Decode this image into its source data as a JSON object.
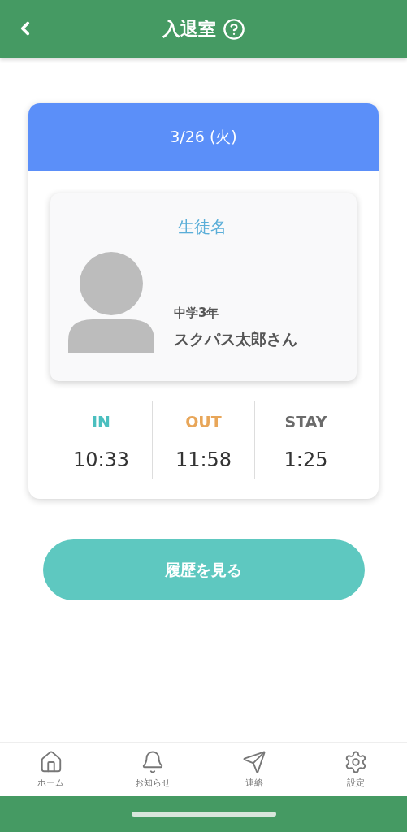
{
  "header": {
    "title": "入退室"
  },
  "record": {
    "date": "3/26 (火)",
    "student_label": "生徒名",
    "grade": "中学3年",
    "name": "スクパス太郎さん",
    "times": [
      {
        "label": "IN",
        "value": "10:33",
        "color": "#4bbfbf"
      },
      {
        "label": "OUT",
        "value": "11:58",
        "color": "#e8a659"
      },
      {
        "label": "STAY",
        "value": "1:25",
        "color": "#6b6b6b"
      }
    ]
  },
  "history_button": "履歴を見る",
  "tab_bar": [
    {
      "label": "ホーム"
    },
    {
      "label": "お知らせ"
    },
    {
      "label": "連絡"
    },
    {
      "label": "設定"
    }
  ]
}
